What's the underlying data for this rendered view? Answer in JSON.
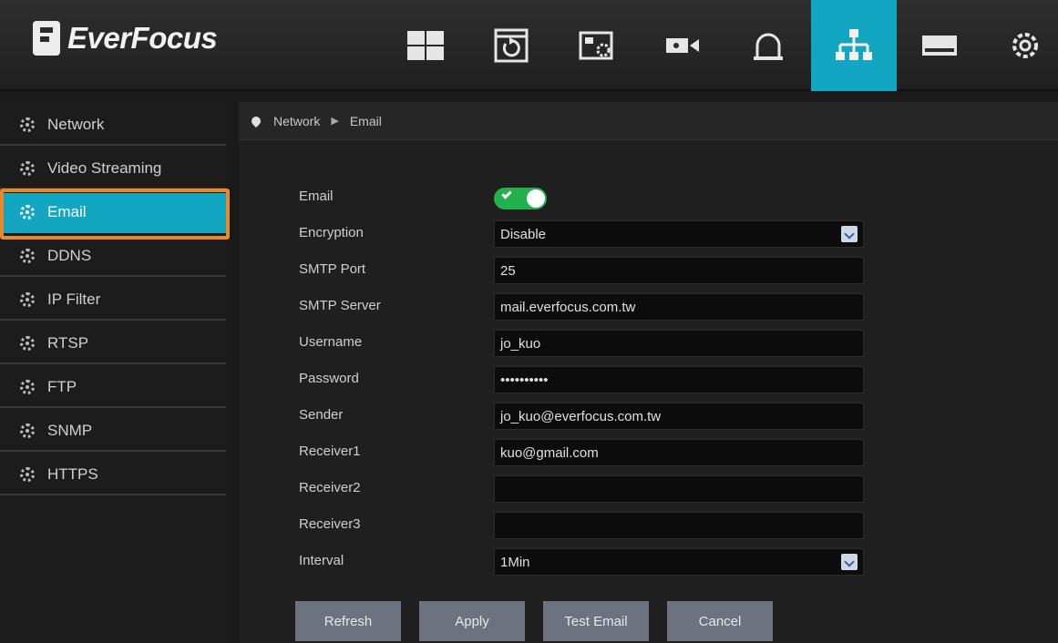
{
  "brand": {
    "name": "EverFocus"
  },
  "nav": [
    {
      "name": "layout-grid-icon",
      "active": false
    },
    {
      "name": "playback-icon",
      "active": false
    },
    {
      "name": "image-settings-icon",
      "active": false
    },
    {
      "name": "camera-icon",
      "active": false
    },
    {
      "name": "alarm-icon",
      "active": false
    },
    {
      "name": "network-icon",
      "active": true
    },
    {
      "name": "storage-icon",
      "active": false
    },
    {
      "name": "settings-icon",
      "active": false
    }
  ],
  "sidebar": {
    "items": [
      {
        "label": "Network"
      },
      {
        "label": "Video Streaming"
      },
      {
        "label": "Email",
        "active": true
      },
      {
        "label": "DDNS"
      },
      {
        "label": "IP Filter"
      },
      {
        "label": "RTSP"
      },
      {
        "label": "FTP"
      },
      {
        "label": "SNMP"
      },
      {
        "label": "HTTPS"
      }
    ]
  },
  "breadcrumb": {
    "parent": "Network",
    "current": "Email"
  },
  "form": {
    "email": {
      "label": "Email",
      "enabled": true
    },
    "encryption": {
      "label": "Encryption",
      "value": "Disable"
    },
    "smtp_port": {
      "label": "SMTP Port",
      "value": "25"
    },
    "smtp_server": {
      "label": "SMTP Server",
      "value": "mail.everfocus.com.tw"
    },
    "username": {
      "label": "Username",
      "value": "jo_kuo"
    },
    "password": {
      "label": "Password",
      "value": "••••••••••"
    },
    "sender": {
      "label": "Sender",
      "value": "jo_kuo@everfocus.com.tw"
    },
    "receiver1": {
      "label": "Receiver1",
      "value": "kuo@gmail.com"
    },
    "receiver2": {
      "label": "Receiver2",
      "value": ""
    },
    "receiver3": {
      "label": "Receiver3",
      "value": ""
    },
    "interval": {
      "label": "Interval",
      "value": "1Min"
    }
  },
  "buttons": {
    "refresh": "Refresh",
    "apply": "Apply",
    "test_email": "Test Email",
    "cancel": "Cancel"
  },
  "colors": {
    "accent": "#13a6c2",
    "toggle_on": "#22b14c",
    "focus": "#e88a2a"
  }
}
